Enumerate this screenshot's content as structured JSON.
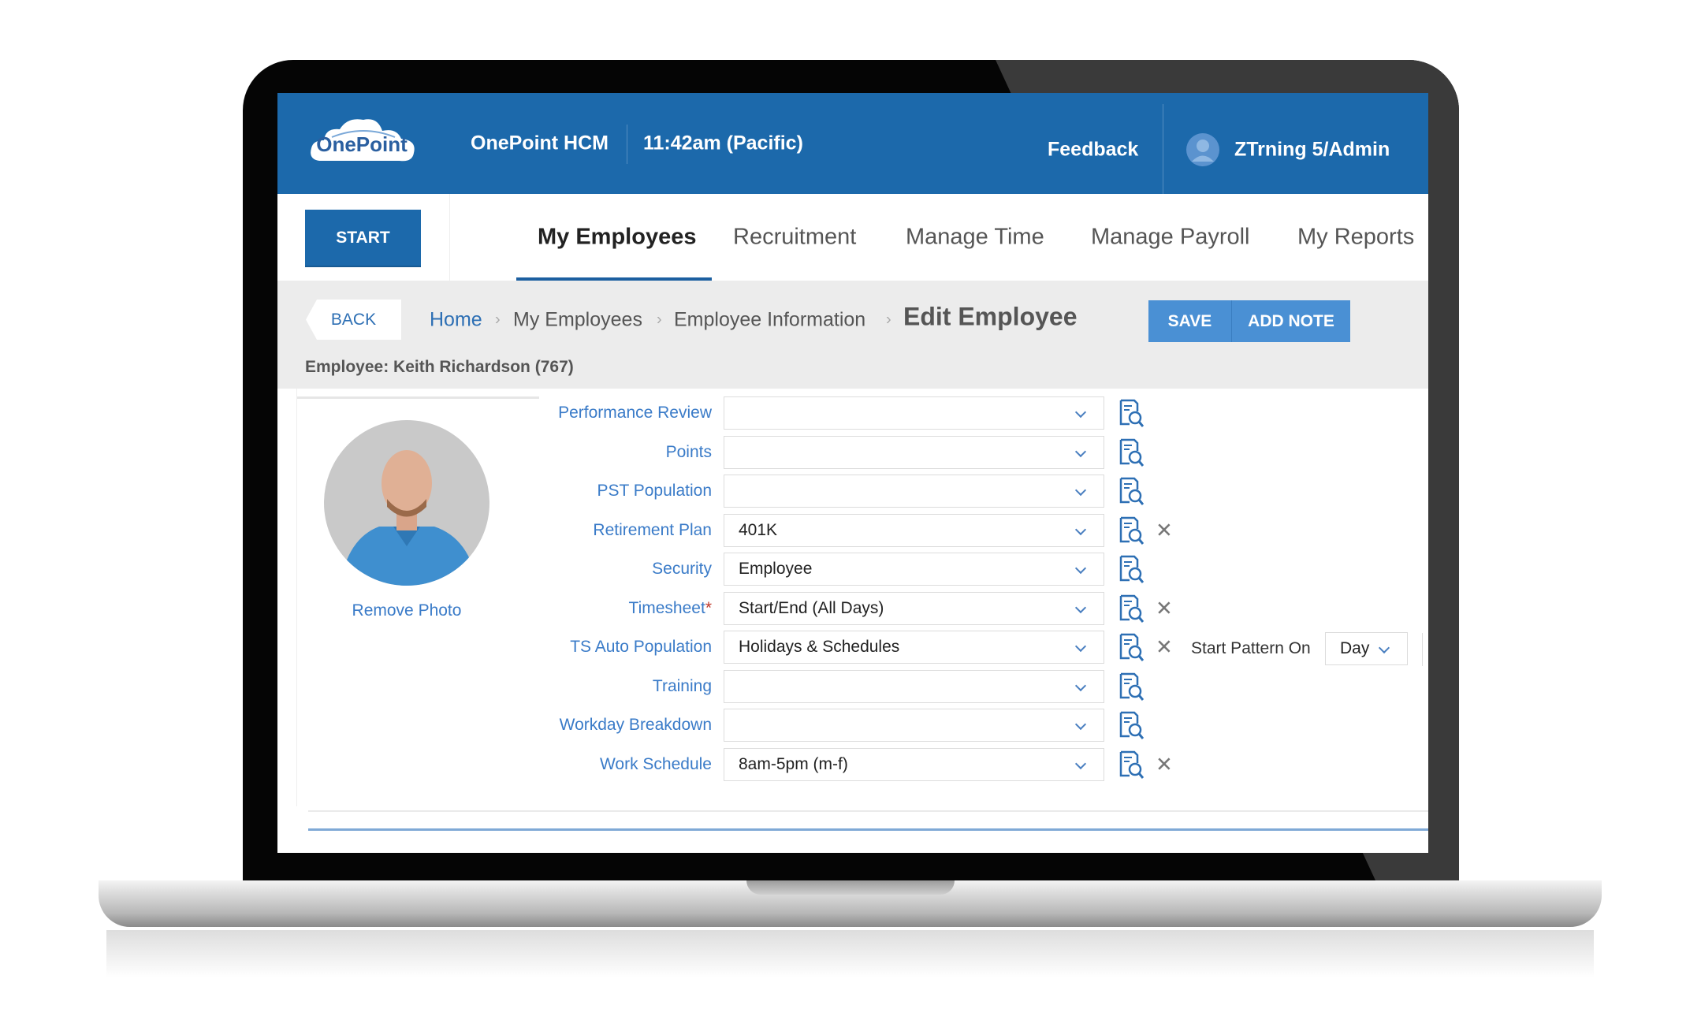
{
  "header": {
    "logo_text": "OnePoint",
    "app_name": "OnePoint HCM",
    "time": "11:42am (Pacific)",
    "feedback_label": "Feedback",
    "user_name": "ZTrning 5/Admin"
  },
  "nav": {
    "start_label": "START",
    "tabs": [
      {
        "label": "My Employees",
        "active": true
      },
      {
        "label": "Recruitment"
      },
      {
        "label": "Manage Time"
      },
      {
        "label": "Manage Payroll"
      },
      {
        "label": "My Reports"
      }
    ]
  },
  "toolbar": {
    "back_label": "BACK",
    "breadcrumb": [
      "Home",
      "My Employees",
      "Employee Information",
      "Edit Employee"
    ],
    "save_label": "SAVE",
    "add_note_label": "ADD NOTE",
    "employee_line": "Employee: Keith Richardson (767)"
  },
  "profile": {
    "remove_photo_label": "Remove Photo"
  },
  "form": {
    "rows": [
      {
        "label": "Performance Review",
        "value": ""
      },
      {
        "label": "Points",
        "value": ""
      },
      {
        "label": "PST Population",
        "value": ""
      },
      {
        "label": "Retirement Plan",
        "value": "401K",
        "clearable": true
      },
      {
        "label": "Security",
        "value": "Employee"
      },
      {
        "label": "Timesheet",
        "value": "Start/End (All Days)",
        "required": true,
        "clearable": true
      },
      {
        "label": "TS Auto Population",
        "value": "Holidays & Schedules",
        "clearable": true
      },
      {
        "label": "Training",
        "value": ""
      },
      {
        "label": "Workday Breakdown",
        "value": ""
      },
      {
        "label": "Work Schedule",
        "value": "8am-5pm (m-f)",
        "clearable": true
      }
    ],
    "required_mark": "*",
    "clear_glyph": "✕",
    "start_pattern_label": "Start Pattern On",
    "start_pattern_value": "Day"
  },
  "colors": {
    "brand": "#1c69ab",
    "button": "#4a90d4",
    "label": "#3a7bc8"
  }
}
